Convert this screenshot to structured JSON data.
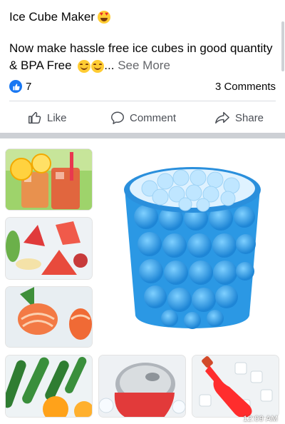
{
  "post": {
    "title": "Ice Cube Maker",
    "title_emoji": "heart-eyes-emoji",
    "text": "Now make hassle free ice cubes in good quantity & BPA Free",
    "text_emojis": [
      "smiling-face-emoji",
      "smiling-face-emoji"
    ],
    "ellipsis": "...",
    "see_more": "See More",
    "like_count": "7",
    "comments_count": "3 Comments"
  },
  "actions": {
    "like_label": "Like",
    "comment_label": "Comment",
    "share_label": "Share"
  },
  "media": {
    "status_time": "12:09 AM",
    "product_color": "#3ba7e6",
    "images": [
      "drink-thumbnail",
      "fruit-thumbnail",
      "salmon-thumbnail",
      "product-image",
      "vegetable-thumbnail",
      "soda-can-thumbnail",
      "bottle-thumbnail"
    ]
  },
  "colors": {
    "accent": "#1877f2",
    "text_secondary": "#65676b",
    "divider": "#dadde1"
  }
}
